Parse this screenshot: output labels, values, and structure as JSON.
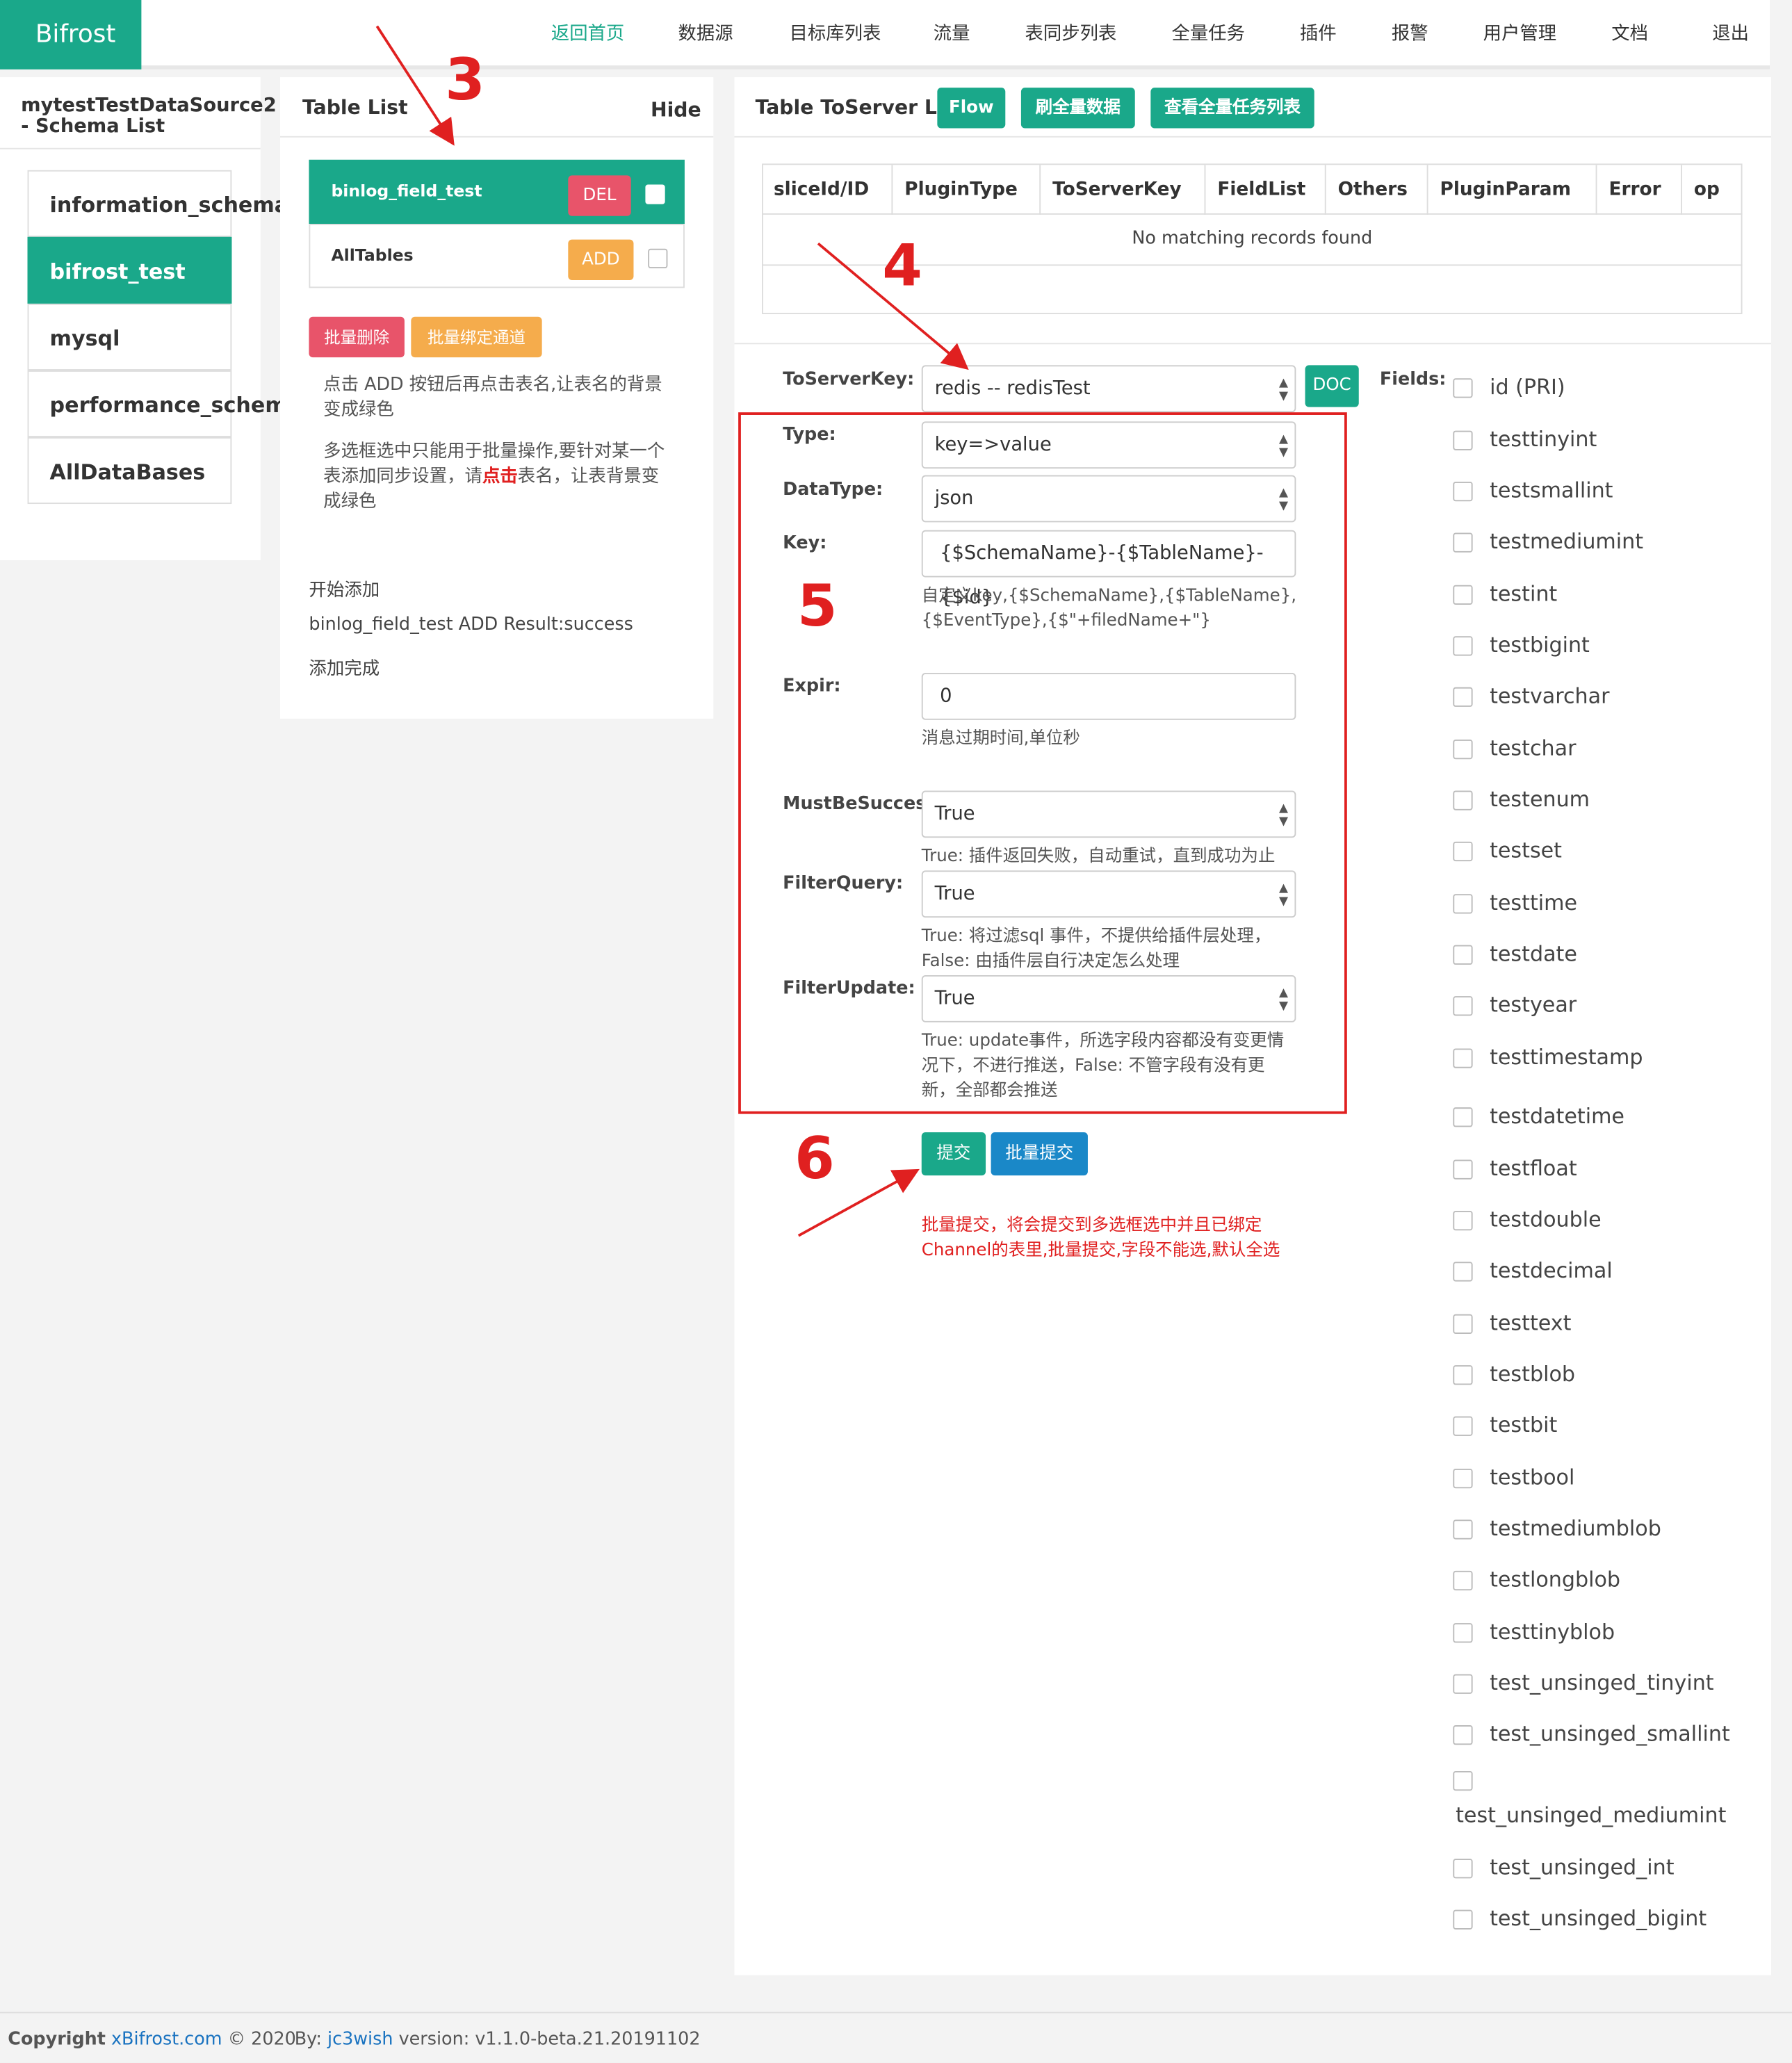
{
  "navbar": {
    "brand": "Bifrost",
    "items": [
      "返回首页",
      "数据源",
      "目标库列表",
      "流量",
      "表同步列表",
      "全量任务",
      "插件",
      "报警",
      "用户管理",
      "文档",
      "退出"
    ]
  },
  "schema_panel": {
    "title_line1": "mytestTestDataSource2",
    "title_line2": "- Schema List",
    "items": [
      "information_schema",
      "bifrost_test",
      "mysql",
      "performance_schema",
      "AllDataBases"
    ]
  },
  "table_panel": {
    "title": "Table List",
    "hide": "Hide",
    "rows": [
      {
        "name": "binlog_field_test",
        "action": "DEL"
      },
      {
        "name": "AllTables",
        "action": "ADD"
      }
    ],
    "batch_delete": "批量删除",
    "batch_bind": "批量绑定通道",
    "help1_line1": "点击 ADD 按钮后再点击表名,让表名的背景",
    "help1_line2": "变成绿色",
    "help2_line1": "多选框选中只能用于批量操作,要针对某一个",
    "help2_line2_pre": "表添加同步设置，请",
    "help2_line2_red": "点击",
    "help2_line2_post": "表名，让表背景变",
    "help2_line3": "成绿色",
    "log": [
      "开始添加",
      "binlog_field_test ADD Result:success",
      "添加完成"
    ]
  },
  "toserver_panel": {
    "title": "Table ToServer List",
    "flow": "Flow",
    "refresh_full": "刷全量数据",
    "view_full_tasks": "查看全量任务列表",
    "columns": [
      "sliceId/ID",
      "PluginType",
      "ToServerKey",
      "FieldList",
      "Others",
      "PluginParam",
      "Error",
      "op"
    ],
    "empty": "No matching records found"
  },
  "form": {
    "toserverkey_label": "ToServerKey:",
    "toserverkey_value": "redis -- redisTest",
    "doc": "DOC",
    "type_label": "Type:",
    "type_value": "key=>value",
    "datatype_label": "DataType:",
    "datatype_value": "json",
    "key_label": "Key:",
    "key_value": "{$SchemaName}-{$TableName}-{$id}",
    "key_help1": "自定义key,{$SchemaName},{$TableName},",
    "key_help2": "{$EventType},{$\"+filedName+\"}",
    "expir_label": "Expir:",
    "expir_value": "0",
    "expir_help": "消息过期时间,单位秒",
    "mustbesuccess_label": "MustBeSuccess",
    "mustbesuccess_value": "True",
    "mustbesuccess_help": "True: 插件返回失败，自动重试，直到成功为止",
    "filterquery_label": "FilterQuery:",
    "filterquery_value": "True",
    "filterquery_help1": "True: 将过滤sql 事件，不提供给插件层处理，",
    "filterquery_help2": "False: 由插件层自行决定怎么处理",
    "filterupdate_label": "FilterUpdate:",
    "filterupdate_value": "True",
    "filterupdate_help1": "True: update事件，所选字段内容都没有变更情",
    "filterupdate_help2": "况下，不进行推送，False: 不管字段有没有更",
    "filterupdate_help3": "新，全部都会推送",
    "submit": "提交",
    "batch_submit": "批量提交",
    "batch_note1": "批量提交，将会提交到多选框选中并且已绑定",
    "batch_note2": "Channel的表里,批量提交,字段不能选,默认全选",
    "fields_label": "Fields:"
  },
  "fields": [
    "id (PRI)",
    "testtinyint",
    "testsmallint",
    "testmediumint",
    "testint",
    "testbigint",
    "testvarchar",
    "testchar",
    "testenum",
    "testset",
    "testtime",
    "testdate",
    "testyear",
    "testtimestamp",
    "testdatetime",
    "testfloat",
    "testdouble",
    "testdecimal",
    "testtext",
    "testblob",
    "testbit",
    "testbool",
    "testmediumblob",
    "testlongblob",
    "testtinyblob",
    "test_unsinged_tinyint",
    "test_unsinged_smallint",
    "test_unsinged_mediumint",
    "test_unsinged_int",
    "test_unsinged_bigint"
  ],
  "annotations": {
    "n3": "3",
    "n4": "4",
    "n5": "5",
    "n6": "6"
  },
  "footer": {
    "copyright": "Copyright",
    "site": "xBifrost.com",
    "year": "© 2020",
    "by": "By:",
    "author": "jc3wish",
    "version": "version: v1.1.0-beta.21.20191102"
  },
  "colors": {
    "primary": "#1aa88a",
    "danger": "#e8546a",
    "warning": "#f5ac4c",
    "info": "#1a88c8",
    "annotation": "#e02020"
  }
}
